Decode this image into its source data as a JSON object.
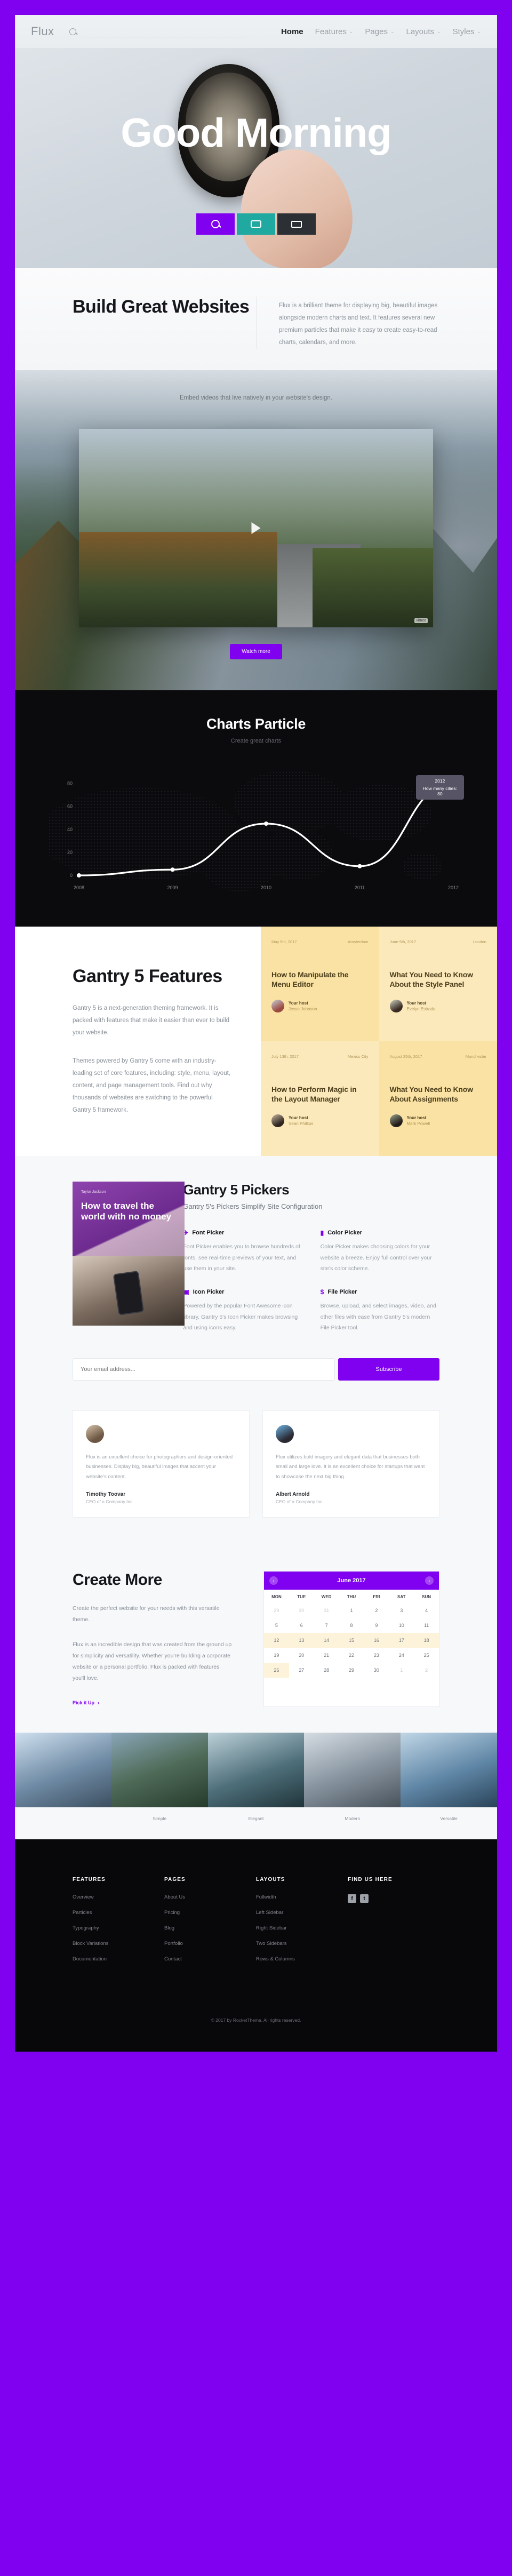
{
  "nav": {
    "logo": "Flux",
    "search_placeholder": "",
    "search_value": "",
    "items": [
      {
        "label": "Home",
        "caret": "",
        "active": true
      },
      {
        "label": "Features",
        "caret": "⌄",
        "active": false
      },
      {
        "label": "Pages",
        "caret": "⌄",
        "active": false
      },
      {
        "label": "Layouts",
        "caret": "⌄",
        "active": false
      },
      {
        "label": "Styles",
        "caret": "⌄",
        "active": false
      }
    ]
  },
  "hero": {
    "title": "Good Morning",
    "buttons": [
      {
        "icon": "search-icon",
        "color": "#8000f0"
      },
      {
        "icon": "camera-icon",
        "color": "#1fa9a0"
      },
      {
        "icon": "monitor-icon",
        "color": "#2c2f34"
      }
    ]
  },
  "build": {
    "heading": "Build Great Websites",
    "paragraph": "Flux is a brilliant theme for displaying big, beautiful images alongside modern charts and text. It features several new premium particles that make it easy to create easy-to-read charts, calendars, and more."
  },
  "video": {
    "caption": "Embed videos that live natively in your website's design.",
    "play_icon": "play-icon",
    "brand_text": "vimeo",
    "watch_label": "Watch more"
  },
  "chart_data": {
    "type": "line",
    "title": "Charts Particle",
    "subtitle": "Create great charts",
    "x": [
      "2008",
      "2009",
      "2010",
      "2011",
      "2012"
    ],
    "values": [
      0,
      5,
      45,
      8,
      80
    ],
    "series": [
      {
        "name": "How many cities",
        "values": [
          0,
          5,
          45,
          8,
          80
        ]
      }
    ],
    "xlabel": "",
    "ylabel": "",
    "ylim": [
      0,
      90
    ],
    "yticks": [
      0,
      20,
      40,
      60,
      80
    ],
    "grid": false,
    "legend": "none",
    "line_color": "#ffffff",
    "background": "#0b0a0d",
    "tooltip": {
      "label": "2012",
      "value": "How many cities: 80"
    }
  },
  "features": {
    "heading": "Gantry 5 Features",
    "paragraph_1": "Gantry 5 is a next-generation theming framework. It is packed with features that make it easier than ever to build your website.",
    "paragraph_2": "Themes powered by Gantry 5 come with an industry-leading set of core features, including: style, menu, layout, content, and page management tools. Find out why thousands of websites are switching to the powerful Gantry 5 framework.",
    "cards": [
      {
        "date": "May 9th, 2017",
        "city": "Amsterdam",
        "title": "How to Manipulate the Menu Editor",
        "host_label": "Your host",
        "host_name": "Jesse Johnson",
        "avatar": "avatar-jesse-johnson",
        "tone": "a"
      },
      {
        "date": "June 5th, 2017",
        "city": "London",
        "title": "What You Need to Know About the Style Panel",
        "host_label": "Your host",
        "host_name": "Evelyn Estrada",
        "avatar": "avatar-evelyn-estrada",
        "tone": "b"
      },
      {
        "date": "July 13th, 2017",
        "city": "Mexico City",
        "title": "How to Perform Magic in the Layout Manager",
        "host_label": "Your host",
        "host_name": "Sean Phillips",
        "avatar": "avatar-sean-phillips",
        "tone": "b"
      },
      {
        "date": "August 25th, 2017",
        "city": "Manchester",
        "title": "What You Need to Know About Assignments",
        "host_label": "Your host",
        "host_name": "Mark Powell",
        "avatar": "avatar-mark-powell",
        "tone": "a"
      }
    ]
  },
  "pickers": {
    "promo": {
      "kicker": "Taylor Jackson",
      "heading": "How to travel the world with no money"
    },
    "heading": "Gantry 5 Pickers",
    "subheading": "Gantry 5's Pickers Simplify Site Configuration",
    "items": [
      {
        "icon": "plane-icon",
        "glyph": "✈",
        "title": "Font Picker",
        "text": "Font Picker enables you to browse hundreds of fonts, see real-time previews of your text, and use them in your site."
      },
      {
        "icon": "briefcase-icon",
        "glyph": "▮",
        "title": "Color Picker",
        "text": "Color Picker makes choosing colors for your website a breeze. Enjoy full control over your site's color scheme."
      },
      {
        "icon": "camera-icon",
        "glyph": "▣",
        "title": "Icon Picker",
        "text": "Powered by the popular Font Awesome icon library, Gantry 5's Icon Picker makes browsing and using icons easy."
      },
      {
        "icon": "dollar-icon",
        "glyph": "$",
        "title": "File Picker",
        "text": "Browse, upload, and select images, video, and other files with ease from Gantry 5's modern File Picker tool."
      }
    ]
  },
  "subscribe": {
    "placeholder": "Your email address...",
    "value": "",
    "button_label": "Subscribe"
  },
  "testimonials": [
    {
      "avatar": "avatar-timothy-toovar",
      "quote": "Flux is an excellent choice for photographers and design-oriented businesses. Display big, beautiful images that accent your website's content.",
      "name": "Timothy Toovar",
      "role": "CEO of a Company Inc."
    },
    {
      "avatar": "avatar-albert-arnold",
      "quote": "Flux utilizes bold imagery and elegant data that businesses both small and large love. It is an excellent choice for startups that want to showcase the next big thing.",
      "name": "Albert Arnold",
      "role": "CEO of a Company Inc."
    }
  ],
  "create": {
    "heading": "Create More",
    "paragraph_1": "Create the perfect website for your needs with this versatile theme.",
    "paragraph_2": "Flux is an incredible design that was created from the ground up for simplicity and versatility. Whether you're building a corporate website or a personal portfolio, Flux is packed with features you'll love.",
    "link_label": "Pick it Up",
    "link_icon": "arrow-right-icon"
  },
  "calendar": {
    "title": "June 2017",
    "prev_icon": "chevron-left-icon",
    "next_icon": "chevron-right-icon",
    "dow": [
      "MON",
      "TUE",
      "WED",
      "THU",
      "FRI",
      "SAT",
      "SUN"
    ],
    "weeks": [
      [
        {
          "d": "29",
          "mut": true
        },
        {
          "d": "30",
          "mut": true
        },
        {
          "d": "31",
          "mut": true
        },
        {
          "d": "1"
        },
        {
          "d": "2"
        },
        {
          "d": "3"
        },
        {
          "d": "4"
        }
      ],
      [
        {
          "d": "5"
        },
        {
          "d": "6"
        },
        {
          "d": "7"
        },
        {
          "d": "8"
        },
        {
          "d": "9"
        },
        {
          "d": "10"
        },
        {
          "d": "11"
        }
      ],
      [
        {
          "d": "12",
          "hl": true
        },
        {
          "d": "13",
          "hl": true
        },
        {
          "d": "14",
          "hl": true
        },
        {
          "d": "15",
          "hl": true
        },
        {
          "d": "16",
          "hl": true
        },
        {
          "d": "17",
          "hl": true
        },
        {
          "d": "18",
          "hl": true
        }
      ],
      [
        {
          "d": "19"
        },
        {
          "d": "20"
        },
        {
          "d": "21"
        },
        {
          "d": "22"
        },
        {
          "d": "23"
        },
        {
          "d": "24"
        },
        {
          "d": "25"
        }
      ],
      [
        {
          "d": "26",
          "hl": true
        },
        {
          "d": "27"
        },
        {
          "d": "28"
        },
        {
          "d": "29"
        },
        {
          "d": "30"
        },
        {
          "d": "1",
          "mut": true
        },
        {
          "d": "2",
          "mut": true
        }
      ]
    ]
  },
  "gallery": [
    {
      "caption": "",
      "tone": "g1"
    },
    {
      "caption": "Simple",
      "tone": "g2"
    },
    {
      "caption": "Elegant",
      "tone": "g3"
    },
    {
      "caption": "Modern",
      "tone": "g4"
    },
    {
      "caption": "Versatile",
      "tone": "g5"
    }
  ],
  "footer": {
    "columns": [
      {
        "heading": "FEATURES",
        "links": [
          "Overview",
          "Particles",
          "Typography",
          "Block Variations",
          "Documentation"
        ]
      },
      {
        "heading": "PAGES",
        "links": [
          "About Us",
          "Pricing",
          "Blog",
          "Portfolio",
          "Contact"
        ]
      },
      {
        "heading": "LAYOUTS",
        "links": [
          "Fullwidth",
          "Left Sidebar",
          "Right Sidebar",
          "Two Sidebars",
          "Rows & Columns"
        ]
      }
    ],
    "social_heading": "FIND US HERE",
    "socials": [
      {
        "icon": "facebook-icon",
        "glyph": "f"
      },
      {
        "icon": "twitter-icon",
        "glyph": "t"
      }
    ],
    "copyright": "© 2017 by RocketTheme. All rights reserved."
  },
  "theme": {
    "accent": "#8000f0",
    "dark": "#0b0a0d",
    "card_yellow": "#fae2a4",
    "card_yellow_light": "#fbe9bb"
  }
}
